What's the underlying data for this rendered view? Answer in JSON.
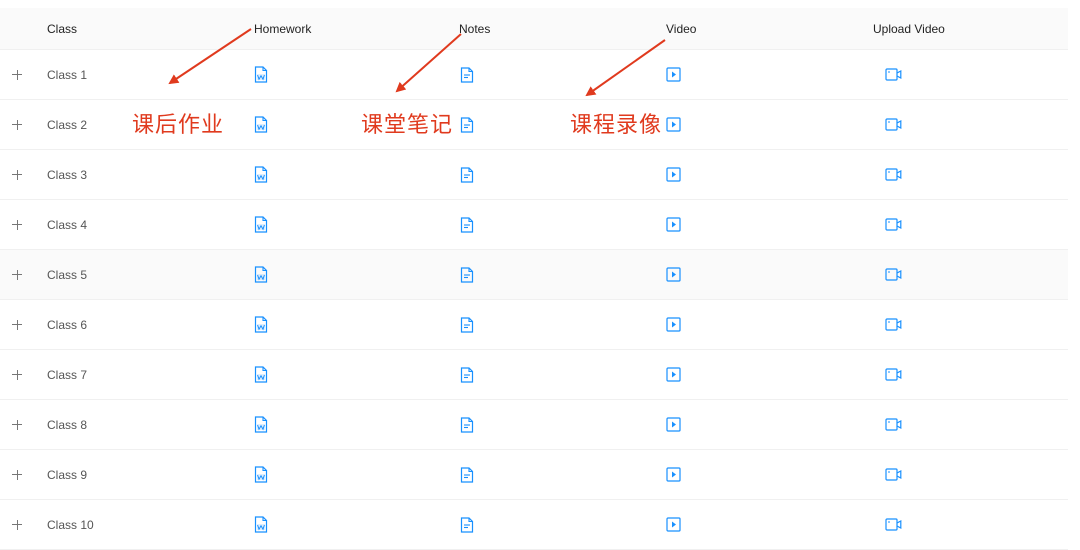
{
  "header": {
    "class": "Class",
    "homework": "Homework",
    "notes": "Notes",
    "video": "Video",
    "upload_video": "Upload Video"
  },
  "rows": [
    {
      "label": "Class 1"
    },
    {
      "label": "Class 2"
    },
    {
      "label": "Class 3"
    },
    {
      "label": "Class 4"
    },
    {
      "label": "Class 5"
    },
    {
      "label": "Class 6"
    },
    {
      "label": "Class 7"
    },
    {
      "label": "Class 8"
    },
    {
      "label": "Class 9"
    },
    {
      "label": "Class 10"
    }
  ],
  "annotations": {
    "homework": "课后作业",
    "notes": "课堂笔记",
    "video": "课程录像"
  },
  "icons": {
    "homework": "word-document-icon",
    "notes": "note-document-icon",
    "video": "play-video-icon",
    "upload": "video-camera-icon"
  },
  "colors": {
    "icon": "#1890ff",
    "annotation": "#e03a1e",
    "header_bg": "#fafafa",
    "border": "#f0f0f0"
  }
}
